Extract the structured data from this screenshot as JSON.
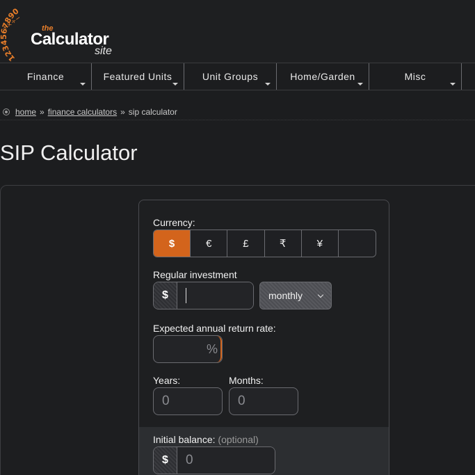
{
  "logo": {
    "digits": "1234567890",
    "symbols": "+×÷−",
    "the": "the",
    "calculator": "Calculator",
    "site": "site",
    "accent": "#e87e2a"
  },
  "nav": {
    "items": [
      {
        "label": "Finance"
      },
      {
        "label": "Featured Units"
      },
      {
        "label": "Unit Groups"
      },
      {
        "label": "Home/Garden"
      },
      {
        "label": "Misc"
      }
    ]
  },
  "breadcrumb": {
    "home": "home",
    "sep1": "»",
    "finance": "finance calculators",
    "sep2": "»",
    "current": "sip calculator"
  },
  "page": {
    "title": "SIP Calculator"
  },
  "form": {
    "currency_label": "Currency:",
    "currencies": [
      "$",
      "€",
      "£",
      "₹",
      "¥",
      ""
    ],
    "selected_currency": "$",
    "regular_investment_label": "Regular investment",
    "regular_investment_symbol": "$",
    "regular_investment_value": "",
    "frequency_value": "monthly",
    "return_rate_label": "Expected annual return rate:",
    "return_rate_unit": "%",
    "years_label": "Years:",
    "years_value": "0",
    "months_label": "Months:",
    "months_value": "0",
    "initial_balance_label": "Initial balance:",
    "initial_balance_optional": "(optional)",
    "initial_balance_symbol": "$",
    "initial_balance_value": "0",
    "active_color": "#d3641c"
  }
}
